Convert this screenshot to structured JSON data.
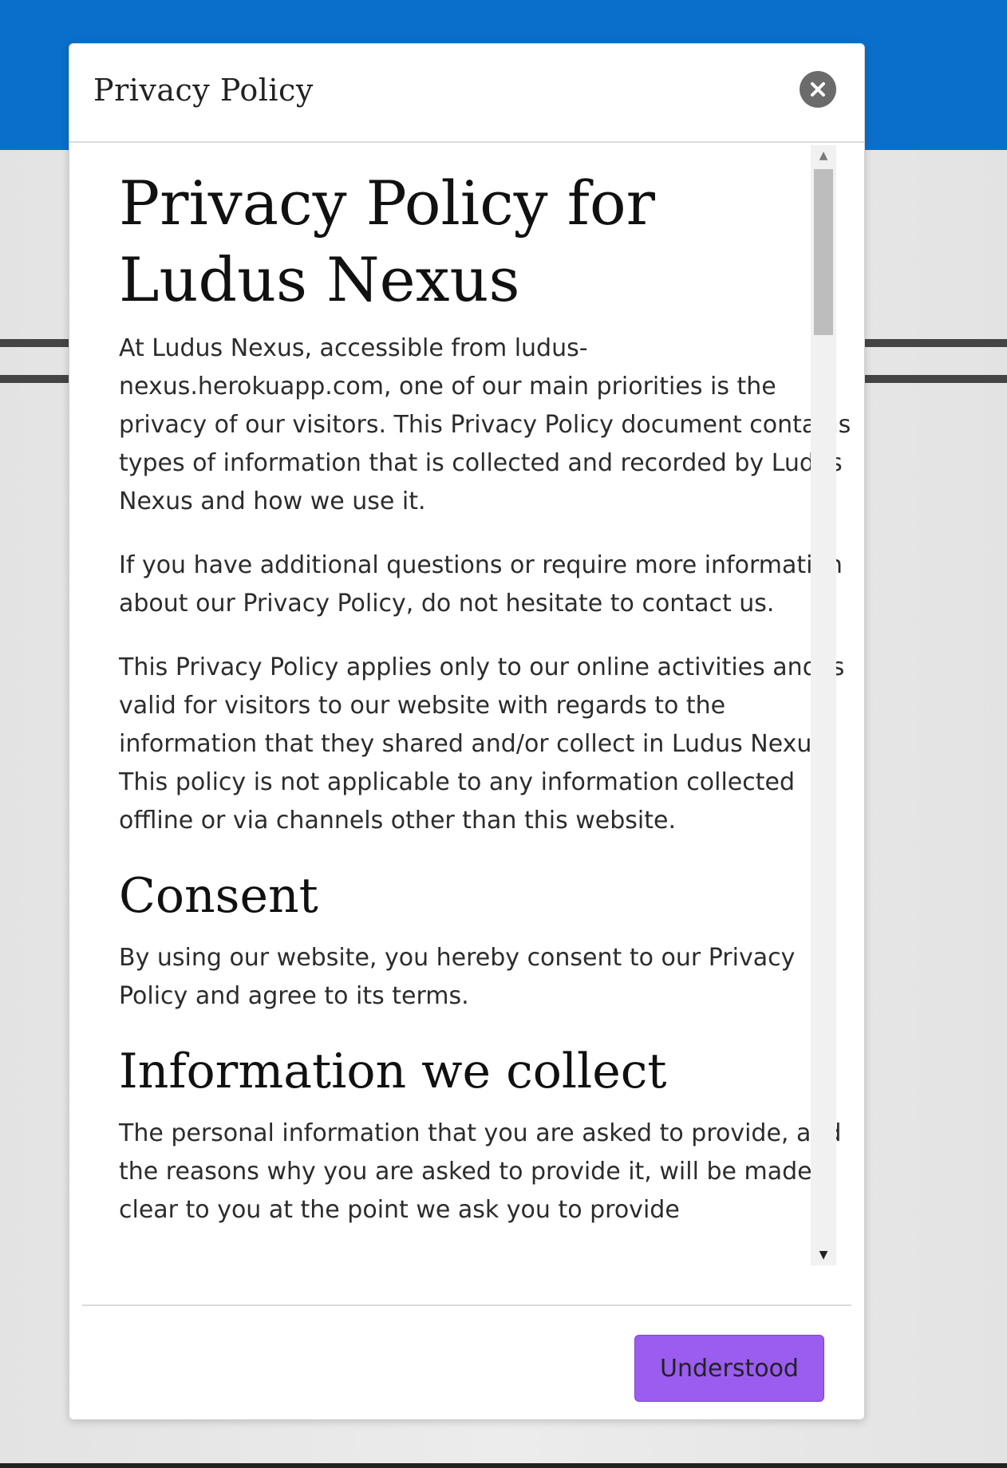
{
  "page": {
    "brand_color": "#0a6fcb",
    "accent_color": "#9b5cf0"
  },
  "modal": {
    "title": "Privacy Policy",
    "close_icon": "close-icon",
    "document": {
      "title": "Privacy Policy for Ludus Nexus",
      "intro_paragraphs": [
        "At Ludus Nexus, accessible from ludus-nexus.herokuapp.com, one of our main priorities is the privacy of our visitors. This Privacy Policy document contains types of information that is collected and recorded by Ludus Nexus and how we use it.",
        "If you have additional questions or require more information about our Privacy Policy, do not hesitate to contact us.",
        "This Privacy Policy applies only to our online activities and is valid for visitors to our website with regards to the information that they shared and/or collect in Ludus Nexus. This policy is not applicable to any information collected offline or via channels other than this website."
      ],
      "sections": [
        {
          "heading": "Consent",
          "paragraph": "By using our website, you hereby consent to our Privacy Policy and agree to its terms."
        },
        {
          "heading": "Information we collect",
          "paragraph": "The personal information that you are asked to provide, and the reasons why you are asked to provide it, will be made clear to you at the point we ask you to provide"
        }
      ]
    },
    "scroll_up_glyph": "▲",
    "scroll_down_glyph": "▼",
    "footer": {
      "understood_label": "Understood"
    }
  }
}
